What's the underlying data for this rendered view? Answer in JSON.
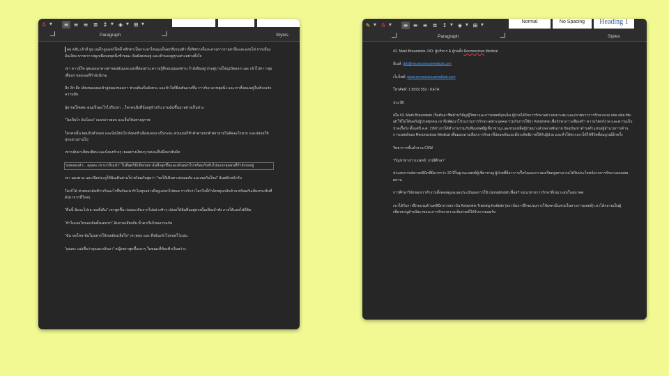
{
  "left_window": {
    "ribbon": {
      "paragraph_label": "Paragraph",
      "styles_label": "Styles"
    },
    "paragraphs": [
      "ผม ตลับ เล้าส์ ทูย บอดีกลูแมดร์นีทที่ พลิกตาเป็นกระจกใสมองเห็นทุกสิ่งรอบตัว ทั้งทิศทางที่และดวงดาวรายล่าสีแและแสงไฟ จากเมืองอันเงียบ บรรยากาศดูเหมือนหยุดนิ่งชั่วขณะ ฉันยังสงบอยู่ และเฝ้ามองดูทุกอย่างอย่างตั้งใจ",
      "เขา ดาวน์ไซ ยุคมองมาดวงตาของฉันและแสงที่ส่องผ่าน ความรู้สึกอบอุ่นแผ่ซ่าน กำลังฝันอยู่ ประตูบานใหญ่เปิดออก และ เข้าไปหา กลุ่มเพื่อนๆ ของเธอที่กำลังนั่งรอ",
      "ลึก ลึก ลึก เสียงของเธอเข้าสู่สมองของเรา ช่างเต้นเป็นจังหวะ และหัวใจก็ยิ่งเต้นแรงขึ้น ราวกับเวลาหยุดนิ่ง และเราทั้งสองอยู่ในห้วงแห่งความฝัน",
      "ฉุ้ย ขอโทษค่ะ คุณเป็นอะไรไปรึเปล่า ...ใครคนนึงที่นั่งอยู่ข้างกัน ถามฉันขึ้นมาอย่างเป็นห่วง",
      "\"ไม่เป็นไร ฉันโอเค\" เธอกล่าวตอบ และยิ้มให้อย่างสุภาพ",
      "ใครคนนั้น ยอมรับคำตอบ และนั่งเงียบไป ยังคงชำเลืองมองมาเป็นระยะ ส่วนเธอก็ทำตัวตามปกติ พยายามไม่คิดอะไรมาก และปล่อยให้ทุกอย่างผ่านไป",
      "เขากลับมาเยี่ยมเยียน และนั่งลงข้างๆ เธออย่างเงียบๆ ก่อนจะยื่นมือมาสัมผัส",
      "\"ลงจอดแล้ว... คุณคะ เขามาถึงแล้ว\" ในที่สุดก็มีเสียงบอก ฉันจึงลุกขึ้นและเดินออกไป พร้อมกับหันไปมองกลุ่มคนที่กำลังรออยู่",
      "เขา มองตาม และเปิดประตูให้ฉันเดินผ่านไป พร้อมกับพูดว่า \"ขอให้เดินทางปลอดภัย และเจอกันใหม่\" ฉันพยักหน้ารับ",
      "ใครก็ได้ ช่วยบอกฉันทีว่าเกิดอะไรขึ้นกันแน่ ทำไมทุกอย่างถึงดูแปลกไปหมด ราวกับว่าโลกใบนี้กำลังหมุนกลับด้าน พร้อมกับเสียงกระซิบที่ดังมาจากที่ไกลๆ",
      "\"คืนนี้ ฉันจะไปรอ เธอที่เดิม\" เขาพูดขึ้น ก่อนจะเดินจากไปอย่างช้าๆ ปล่อยให้ฉันยืนอยู่ตรงนั้นเพียงลำพัง ภายใต้แสงไฟสีส้ม",
      "\"ทำไมเธอไม่บอกฉันตั้งแต่แรก\" ฉันถามเสียงสั่น น้ำตาเริ่มไหลอาบแก้ม",
      "\"ฉัน ขอโทษ ฉันไม่อยากให้เธอต้องเสียใจ\" เขาตอบ และ ดึงฉันเข้าไปกอดไว้แน่น",
      "\"คุณคะ แม่เชื่อว่าคุณจะกลับมา\" หญิงชราพูดขึ้นเบาๆ ในขณะที่ท้องฟ้าเริ่มสว่าง"
    ]
  },
  "right_window": {
    "ribbon": {
      "paragraph_label": "Paragraph",
      "styles_label": "Styles",
      "styles": [
        "Normal",
        "No Spacing",
        "Heading 1"
      ]
    },
    "header_lines": [
      {
        "label": "#2. Mark Braunstein, DO- ผู้บริหาร & ผู้ก่อตั้ง ",
        "value": "Reconscious",
        "suffix": " Medical"
      },
      {
        "label": "อีเมล์: ",
        "value": "drb@reconsciousmedical.com"
      },
      {
        "label": "เว็บไซต์: ",
        "value": "www.reconsciousmedical.com"
      },
      {
        "label": "โทรศัพท์: 1 (833) 552 - KETA"
      },
      {
        "label": "ประวัติ:"
      }
    ],
    "paragraphs": [
      "เมื่อ #3. Mark Braunstein เริ่มต้นอาชีพด้านวิสัญญีวิทยาและการแพทย์ฉุกเฉิน ผู้ป่วยได้รับการรักษาอย่างเหมาะสม และเขาพบว่าการรักษาแบบ one-size-fits-all ใช้ไม่ได้ผลกับผู้ป่วยทุกคน เขาจึงพัฒนาโปรแกรมการรักษาเฉพาะบุคคล ร่วมกับการใช้ยา Ketamine เพื่อรักษาภาวะซึมเศร้า ความวิตกกังวล และความเจ็บปวดเรื้อรัง ตั้งแต่ปี ค.ศ. 1997 เขาได้ทำงานร่วมกับทีมแพทย์ผู้เชี่ยวชาญ และช่วยเหลือผู้ป่วยมาแล้วหลายพันราย ปัจจุบันเขาดำรงตำแหน่งผู้อำนวยการด้านการแพทย์ของ Reconscious Medical เพื่อมอบทางเลือกการรักษาที่ปลอดภัยและมีประสิทธิภาพให้กับผู้ป่วย และทำให้พวกเขาได้ใช้ชีวิตที่สมบูรณ์อีกครั้ง",
      "วิทยาการชั้นนำงาน CSW",
      "\"กัญชาทางการแพทย์: กรณีศึกษา\"",
      "ประสบการณ์ทางคลินิกที่มีมากกว่า 20 ปีในฐานะแพทย์ผู้เชี่ยวชาญ ผู้ป่วยที่มีอาการเรื้อรังและความเครียดสูงสามารถได้รับประโยชน์จากการรักษาแบบผสมผสาน",
      "การศึกษาวิจัยของเราทำงานทั้งคอยดูแลและประเมินผลการใช้ cannabinoid เพื่อสร้างแนวทางการรักษาที่เหมาะสมในอนาคต",
      "เขาได้รับการฝึกอบรมด้านคลินิกจากสถาบัน Ketamine Training Institute (สถาบันการฝึกอบรมการใช้เคตามีนช่วยในทางการแพทย์) เขาได้กลายเป็นผู้เชี่ยวชาญด้านจิตเวชและการรักษาความเจ็บปวดที่ได้รับการยอมรับ"
    ]
  },
  "colors": {
    "background": "#f2f993",
    "window_bg": "#262626",
    "link": "#4fa3ff",
    "font_red": "#e0403a",
    "highlight_yellow": "#f5e23a"
  },
  "icons": [
    "font-color-icon",
    "align-left-icon",
    "align-center-icon",
    "align-right-icon",
    "justify-icon",
    "line-spacing-icon",
    "shading-icon",
    "borders-icon",
    "highlight-icon"
  ]
}
